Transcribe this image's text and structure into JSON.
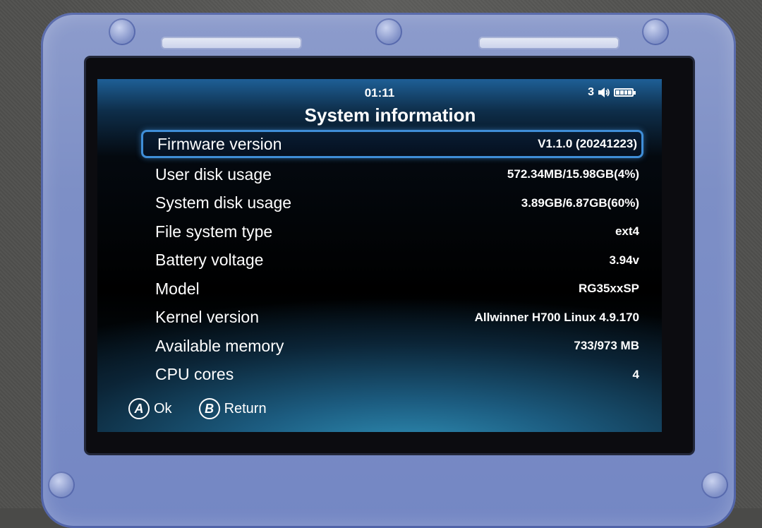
{
  "status_bar": {
    "time": "01:11",
    "volume_level": "3",
    "volume_icon": "speaker-icon",
    "battery_icon": "battery-icon"
  },
  "page": {
    "title": "System information"
  },
  "info_rows": [
    {
      "label": "Firmware version",
      "value": "V1.1.0 (20241223)",
      "selected": true
    },
    {
      "label": "User disk usage",
      "value": "572.34MB/15.98GB(4%)"
    },
    {
      "label": "System disk usage",
      "value": "3.89GB/6.87GB(60%)"
    },
    {
      "label": "File system type",
      "value": "ext4"
    },
    {
      "label": "Battery voltage",
      "value": "3.94v"
    },
    {
      "label": "Model",
      "value": "RG35xxSP"
    },
    {
      "label": "Kernel version",
      "value": "Allwinner H700 Linux 4.9.170"
    },
    {
      "label": "Available memory",
      "value": "733/973 MB"
    },
    {
      "label": "CPU cores",
      "value": "4"
    }
  ],
  "footer": {
    "a_key": "A",
    "a_label": "Ok",
    "b_key": "B",
    "b_label": "Return"
  },
  "colors": {
    "selection_border": "#3f8ed8",
    "device_shell": "#7d8fc6"
  }
}
